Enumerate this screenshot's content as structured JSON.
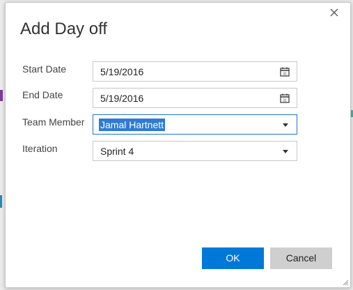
{
  "dialog": {
    "title": "Add Day off",
    "close_icon": "close-icon",
    "fields": {
      "start_date": {
        "label": "Start Date",
        "value": "5/19/2016",
        "icon": "calendar-icon"
      },
      "end_date": {
        "label": "End Date",
        "value": "5/19/2016",
        "icon": "calendar-icon"
      },
      "team_member": {
        "label": "Team Member",
        "value": "Jamal Hartnett",
        "icon": "chevron-down-icon"
      },
      "iteration": {
        "label": "Iteration",
        "value": "Sprint 4",
        "icon": "chevron-down-icon"
      }
    },
    "buttons": {
      "ok": "OK",
      "cancel": "Cancel"
    },
    "colors": {
      "primary": "#0078d7",
      "focus_border": "#1f74c6",
      "selection": "#2e7bd6",
      "secondary_button": "#cfcfcf"
    }
  }
}
